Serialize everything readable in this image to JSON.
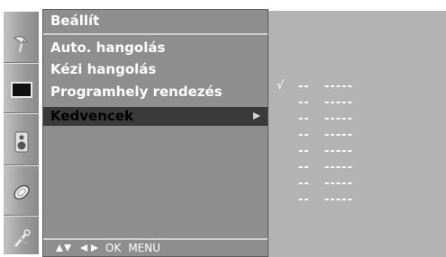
{
  "menu": {
    "title": "Beállít",
    "items": [
      {
        "label": "Auto. hangolás"
      },
      {
        "label": "Kézi hangolás"
      },
      {
        "label": "Programhely rendezés"
      },
      {
        "label": "Kedvencek"
      }
    ],
    "selected_index": 3,
    "footer": {
      "ok_label": "OK",
      "menu_label": "MENU"
    }
  },
  "side_icons": [
    {
      "name": "antenna-icon"
    },
    {
      "name": "screen-icon"
    },
    {
      "name": "speaker-icon"
    },
    {
      "name": "clock-icon"
    },
    {
      "name": "tools-icon"
    }
  ],
  "favourites": {
    "check_mark": "√",
    "rows": [
      {
        "num": "--",
        "name": "-----"
      },
      {
        "num": "--",
        "name": "-----"
      },
      {
        "num": "--",
        "name": "-----"
      },
      {
        "num": "--",
        "name": "-----"
      },
      {
        "num": "--",
        "name": "-----"
      },
      {
        "num": "--",
        "name": "-----"
      },
      {
        "num": "--",
        "name": "-----"
      },
      {
        "num": "--",
        "name": "-----"
      }
    ]
  },
  "colors": {
    "menu_bg": "#8e8e8e",
    "selected_bg": "#3a3a3a",
    "sub_panel_bg": "#b3b3b3",
    "text": "#ffffff"
  }
}
